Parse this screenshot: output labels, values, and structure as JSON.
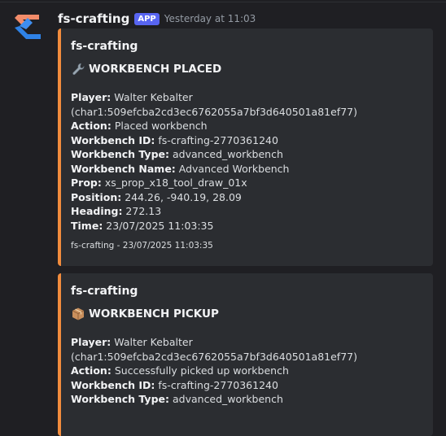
{
  "message": {
    "author": "fs-crafting",
    "badge": "APP",
    "timestamp": "Yesterday at 11:03"
  },
  "embeds": [
    {
      "author": "fs-crafting",
      "title_icon": "wrench-icon",
      "title": "WORKBENCH PLACED",
      "fields": [
        {
          "label": "Player:",
          "value": " Walter Kebalter"
        },
        {
          "label": "",
          "value": "(char1:509efcba2cd3ec6762055a7bf3d640501a81ef77)"
        },
        {
          "label": "Action:",
          "value": " Placed workbench"
        },
        {
          "label": "Workbench ID:",
          "value": " fs-crafting-2770361240"
        },
        {
          "label": "Workbench Type:",
          "value": " advanced_workbench"
        },
        {
          "label": "Workbench Name:",
          "value": " Advanced Workbench"
        },
        {
          "label": "Prop:",
          "value": " xs_prop_x18_tool_draw_01x"
        },
        {
          "label": "Position:",
          "value": " 244.26, -940.19, 28.09"
        },
        {
          "label": "Heading:",
          "value": " 272.13"
        },
        {
          "label": "Time:",
          "value": " 23/07/2025 11:03:35"
        }
      ],
      "footer": "fs-crafting - 23/07/2025 11:03:35"
    },
    {
      "author": "fs-crafting",
      "title_icon": "package-icon",
      "title": "WORKBENCH PICKUP",
      "fields": [
        {
          "label": "Player:",
          "value": " Walter Kebalter"
        },
        {
          "label": "",
          "value": "(char1:509efcba2cd3ec6762055a7bf3d640501a81ef77)"
        },
        {
          "label": "Action:",
          "value": " Successfully picked up workbench"
        },
        {
          "label": "Workbench ID:",
          "value": " fs-crafting-2770361240"
        },
        {
          "label": "Workbench Type:",
          "value": " advanced_workbench"
        }
      ]
    }
  ],
  "colors": {
    "background": "#1f1f23",
    "embed_background": "#2b2d31",
    "embed_accent": "#f28c3d",
    "badge": "#5865f2"
  }
}
